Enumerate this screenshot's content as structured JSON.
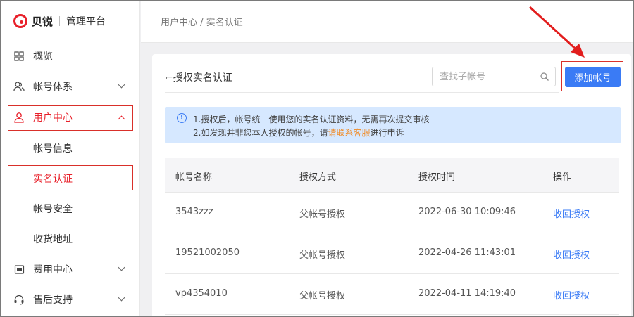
{
  "brand": {
    "name": "贝锐",
    "subtitle": "管理平台"
  },
  "sidebar": {
    "items": [
      {
        "label": "概览",
        "icon": "grid-icon"
      },
      {
        "label": "帐号体系",
        "icon": "users-icon"
      },
      {
        "label": "用户中心",
        "icon": "user-icon",
        "expanded": true,
        "children": [
          {
            "label": "帐号信息"
          },
          {
            "label": "实名认证",
            "active": true
          },
          {
            "label": "帐号安全"
          },
          {
            "label": "收货地址"
          }
        ]
      },
      {
        "label": "费用中心",
        "icon": "wallet-icon"
      },
      {
        "label": "售后支持",
        "icon": "headset-icon"
      }
    ]
  },
  "breadcrumb": "用户中心 / 实名认证",
  "card": {
    "title": "⌐授权实名认证",
    "search_placeholder": "查找子帐号",
    "add_button": "添加帐号"
  },
  "notice": {
    "line1": "1.授权后，帐号统一使用您的实名认证资料，无需再次提交审核",
    "line2_prefix": "2.如发现并非您本人授权的帐号，请",
    "line2_link": "请联系客服",
    "line2_suffix": "进行申诉"
  },
  "table": {
    "headers": [
      "帐号名称",
      "授权方式",
      "授权时间",
      "操作"
    ],
    "rows": [
      {
        "account": "3543zzz",
        "method": "父帐号授权",
        "time": "2022-06-30 10:09:46",
        "action": "收回授权"
      },
      {
        "account": "19521002050",
        "method": "父帐号授权",
        "time": "2022-04-26 11:43:01",
        "action": "收回授权"
      },
      {
        "account": "vp4354010",
        "method": "父帐号授权",
        "time": "2022-04-11 14:19:40",
        "action": "收回授权"
      }
    ]
  },
  "colors": {
    "brand": "#e8202a",
    "primary": "#3a7bf5",
    "notice_bg": "#d6e8ff",
    "link_orange": "#f08a24",
    "annotation_red": "#d9302a"
  }
}
